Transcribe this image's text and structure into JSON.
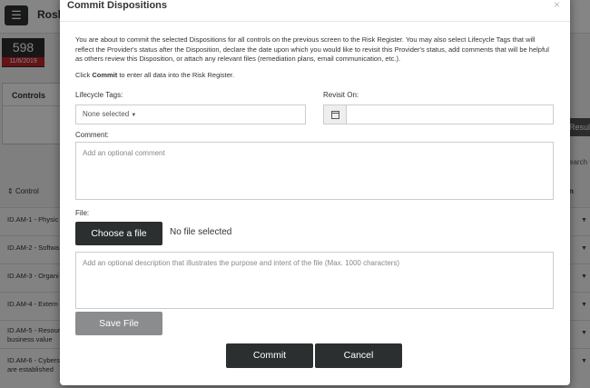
{
  "background": {
    "app_title": "Rosl",
    "menu_icon": "hamburger-icon",
    "score": {
      "value": "598",
      "date": "11/6/2019"
    },
    "controls_label": "Controls",
    "results_button": "Resul",
    "search_label": "earch",
    "table": {
      "columns": [
        "Control",
        "n"
      ],
      "rows": [
        "ID.AM-1 - Physic",
        "ID.AM-2 - Softwa",
        "ID.AM-3 - Organi",
        "ID.AM-4 - Extern",
        "ID.AM-5 - Resour\nbusiness value",
        "ID.AM-6 - Cyberse\nare established"
      ]
    }
  },
  "modal": {
    "title": "Commit Dispositions",
    "close_glyph": "×",
    "intro": "You are about to commit the selected Dispositions for all controls on the previous screen to the Risk Register. You may also select Lifecycle Tags that will reflect the Provider's status after the Disposition, declare the date upon which you would like to revisit this Provider's status, add comments that will be helpful as others review this Disposition, or attach any relevant files (remediation plans, email communication, etc.).",
    "hint_prefix": "Click ",
    "hint_strong": "Commit",
    "hint_suffix": " to enter all data into the Risk Register.",
    "lifecycle_label": "Lifecycle Tags:",
    "lifecycle_value": "None selected",
    "revisit_label": "Revisit On:",
    "revisit_value": "",
    "comment_label": "Comment:",
    "comment_placeholder": "Add an optional comment",
    "file_label": "File:",
    "choose_file": "Choose a file",
    "file_status": "No file selected",
    "file_desc_placeholder": "Add an optional description that illustrates the purpose and intent of the file (Max. 1000 characters)",
    "save_file": "Save File",
    "commit": "Commit",
    "cancel": "Cancel"
  }
}
